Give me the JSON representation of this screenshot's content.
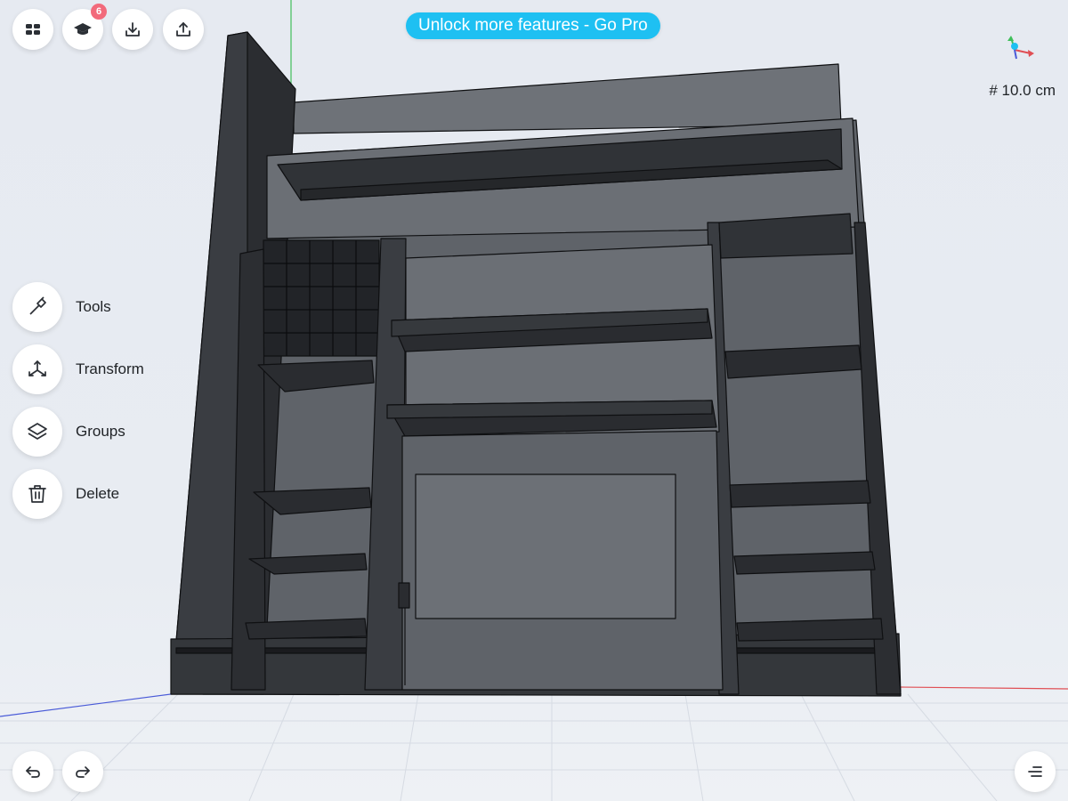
{
  "app": {
    "promo_label": "Unlock more features - Go Pro",
    "learn_badge_count": "6",
    "grid_size": "10.0 cm"
  },
  "toolbar": {
    "top_left": [
      {
        "icon": "menu-grid-icon"
      },
      {
        "icon": "graduation-cap-icon"
      },
      {
        "icon": "import-icon"
      },
      {
        "icon": "share-icon"
      }
    ]
  },
  "tools": [
    {
      "label": "Tools",
      "icon": "hammer-icon"
    },
    {
      "label": "Transform",
      "icon": "transform-icon"
    },
    {
      "label": "Groups",
      "icon": "layers-icon"
    },
    {
      "label": "Delete",
      "icon": "trash-icon"
    }
  ],
  "bottom": {
    "left": [
      {
        "icon": "undo-icon"
      },
      {
        "icon": "redo-icon"
      }
    ],
    "right": {
      "icon": "list-menu-icon"
    }
  },
  "colors": {
    "promo": "#1ec0f2",
    "badge": "#f26a7b",
    "model_face": "#6b6f75",
    "model_dark": "#2f3236",
    "axis_x": "#e04f55",
    "axis_y": "#3fbf5a",
    "axis_z": "#4a5bd8"
  }
}
